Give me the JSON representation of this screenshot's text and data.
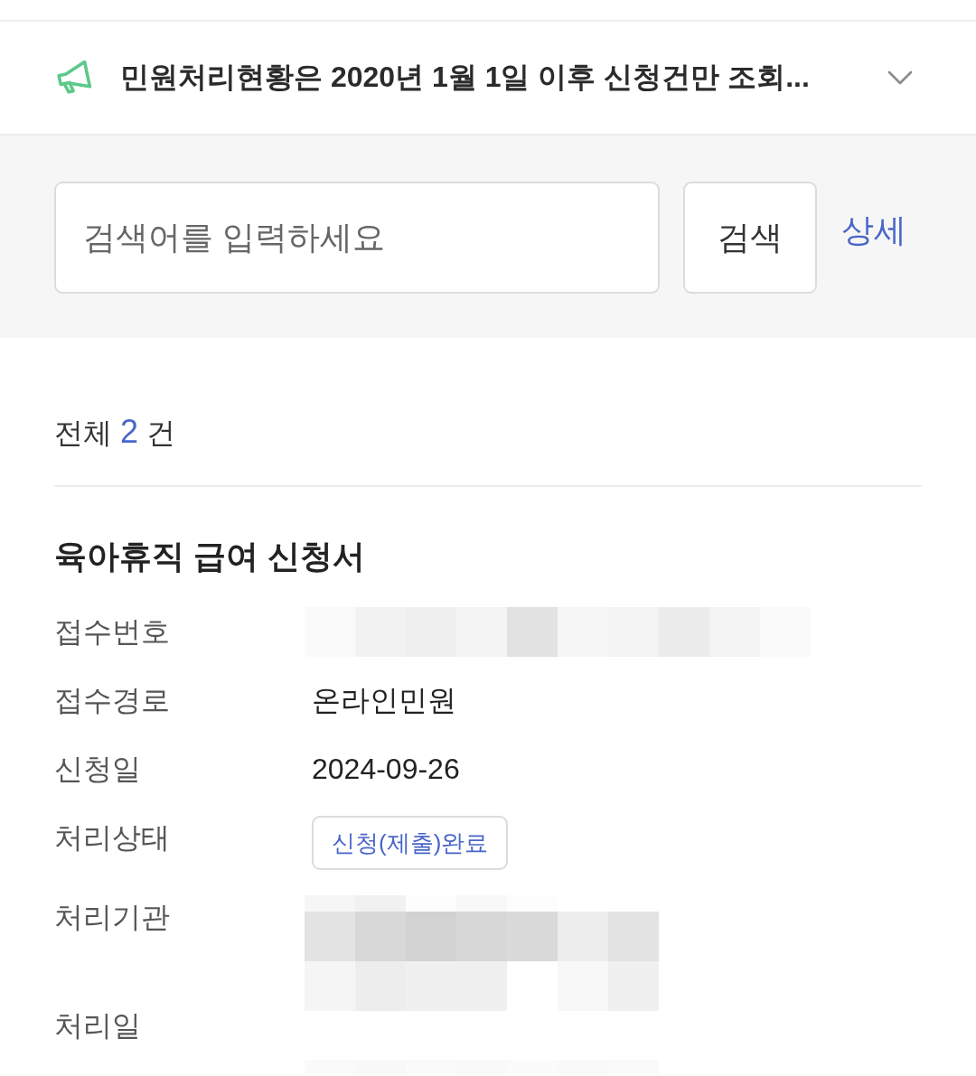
{
  "notice": {
    "text": "민원처리현황은 2020년 1월 1일 이후 신청건만 조회...",
    "expanded": false
  },
  "search": {
    "placeholder": "검색어를 입력하세요",
    "button": "검색",
    "detail_link": "상세"
  },
  "result_count": {
    "prefix": "전체",
    "count": "2",
    "suffix": "건"
  },
  "items": [
    {
      "title": "육아휴직 급여 신청서",
      "fields": [
        {
          "label": "접수번호",
          "kind": "redacted"
        },
        {
          "label": "접수경로",
          "kind": "text",
          "value": "온라인민원"
        },
        {
          "label": "신청일",
          "kind": "text",
          "value": "2024-09-26"
        },
        {
          "label": "처리상태",
          "kind": "badge",
          "value": "신청(제출)완료"
        },
        {
          "label": "처리기관",
          "kind": "redacted"
        },
        {
          "label": "처리일",
          "kind": "redacted"
        }
      ]
    }
  ]
}
